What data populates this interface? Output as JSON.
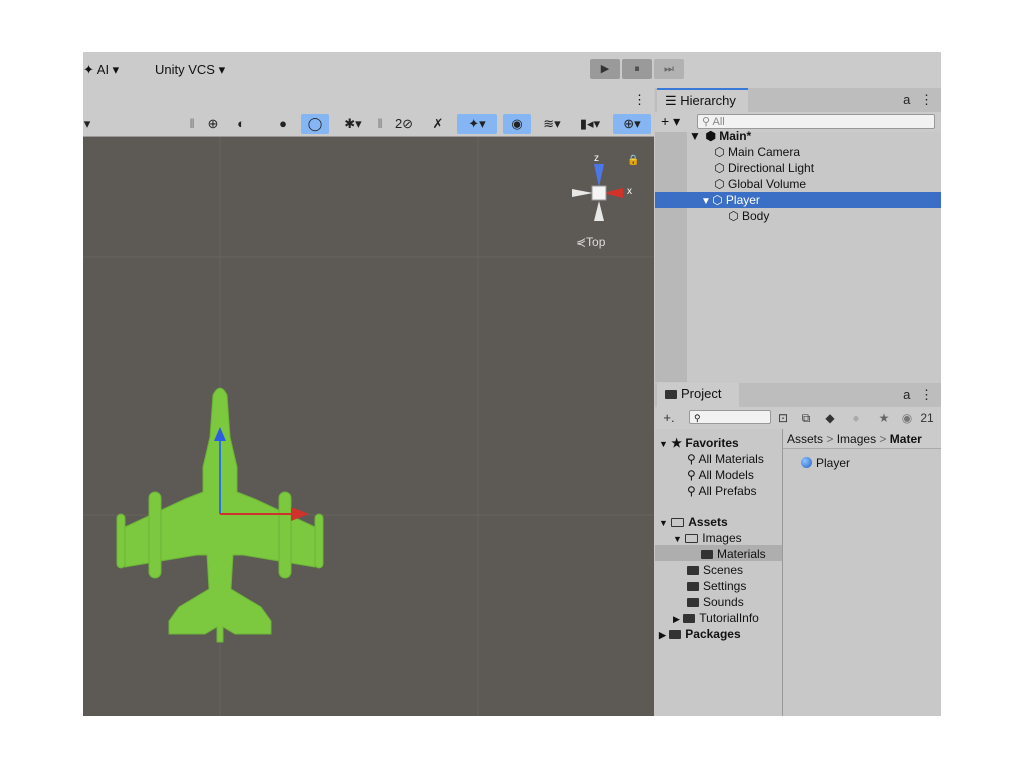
{
  "topbar": {
    "ai_menu": "✦ AI ▾",
    "vcs_menu": "Unity VCS ▾",
    "play_icon": "▶",
    "pause_icon": "⏸",
    "step_icon": "⏭"
  },
  "scene_toolbar": {
    "more": "⋮",
    "dropdown_arrow": "▾"
  },
  "viewport": {
    "gizmo_z": "z",
    "gizmo_x": "x",
    "view_label": "⋞Top"
  },
  "hierarchy": {
    "tab_label": "Hierarchy",
    "lock_icon": "a",
    "more_icon": "⋮",
    "add_label": "+ ▾",
    "search_placeholder": "All",
    "scene_name": "Main*",
    "items": [
      "Main Camera",
      "Directional Light",
      "Global Volume",
      "Player",
      "Body"
    ]
  },
  "project": {
    "tab_label": "Project",
    "lock_icon": "a",
    "more_icon": "⋮",
    "add_label": "+.",
    "count": "21",
    "favorites_label": "Favorites",
    "favorites": [
      "All Materials",
      "All Models",
      "All Prefabs"
    ],
    "assets_label": "Assets",
    "images_label": "Images",
    "materials_label": "Materials",
    "folders": [
      "Scenes",
      "Settings",
      "Sounds",
      "TutorialInfo"
    ],
    "packages_label": "Packages",
    "breadcrumb": [
      "Assets",
      "Images",
      "Mater"
    ],
    "breadcrumb_sep": ">",
    "asset_item": "Player"
  },
  "colors": {
    "selection": "#3b6fc5",
    "plane_green": "#7cc83f",
    "viewport_bg": "#5d5955",
    "toggle_blue": "#85b5f2"
  }
}
